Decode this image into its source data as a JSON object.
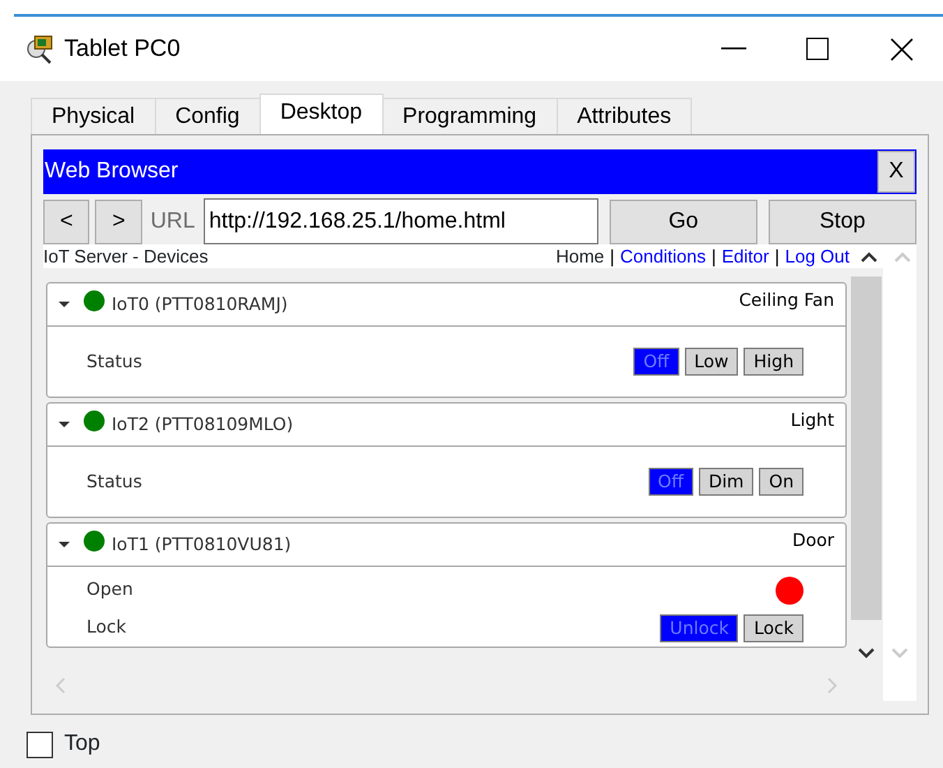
{
  "window": {
    "title": "Tablet PC0"
  },
  "tabs": [
    {
      "label": "Physical",
      "selected": false
    },
    {
      "label": "Config",
      "selected": false
    },
    {
      "label": "Desktop",
      "selected": true
    },
    {
      "label": "Programming",
      "selected": false
    },
    {
      "label": "Attributes",
      "selected": false
    }
  ],
  "browser": {
    "title": "Web Browser",
    "close": "X",
    "back": "<",
    "forward": ">",
    "url_label": "URL",
    "url": "http://192.168.25.1/home.html",
    "go": "Go",
    "stop": "Stop"
  },
  "page": {
    "heading": "IoT Server - Devices",
    "links": [
      {
        "label": "Home",
        "kind": "plain"
      },
      {
        "label": "Conditions",
        "kind": "link"
      },
      {
        "label": "Editor",
        "kind": "link"
      },
      {
        "label": "Log Out",
        "kind": "link"
      }
    ],
    "separator": "|"
  },
  "devices": [
    {
      "name": "IoT0 (PTT0810RAMJ)",
      "type": "Ceiling Fan",
      "color": "#008000",
      "expanded": true,
      "rows": [
        {
          "kind": "buttons",
          "label": "Status",
          "options": [
            {
              "label": "Off",
              "selected": true
            },
            {
              "label": "Low",
              "selected": false
            },
            {
              "label": "High",
              "selected": false
            }
          ]
        }
      ]
    },
    {
      "name": "IoT2 (PTT08109MLO)",
      "type": "Light",
      "color": "#008000",
      "expanded": true,
      "rows": [
        {
          "kind": "buttons",
          "label": "Status",
          "options": [
            {
              "label": "Off",
              "selected": true
            },
            {
              "label": "Dim",
              "selected": false
            },
            {
              "label": "On",
              "selected": false
            }
          ]
        }
      ]
    },
    {
      "name": "IoT1 (PTT0810VU81)",
      "type": "Door",
      "color": "#008000",
      "expanded": true,
      "rows": [
        {
          "kind": "indicator",
          "label": "Open",
          "color": "#ff0000"
        },
        {
          "kind": "buttons",
          "label": "Lock",
          "options": [
            {
              "label": "Unlock",
              "selected": true
            },
            {
              "label": "Lock",
              "selected": false
            }
          ]
        }
      ]
    }
  ],
  "top_checkbox": {
    "label": "Top",
    "checked": false
  }
}
